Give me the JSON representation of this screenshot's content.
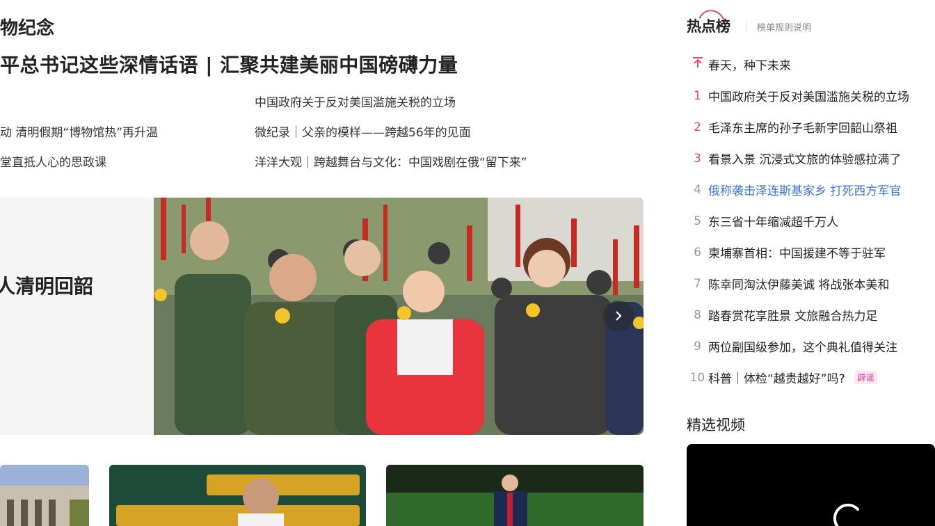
{
  "main": {
    "section_title": "物纪念",
    "headline": "平总书记这些深情话语 | 汇聚共建美丽中国磅礴力量",
    "sub_links": [
      "中国政府关于反对美国滥施关税的立场",
      "动 清明假期“博物馆热”再升温",
      "微纪录｜父亲的模样——跨越56年的见面",
      "堂直抵人心的思政课",
      "洋洋大观｜跨越舞台与文化：中国戏剧在俄“留下来”"
    ],
    "feature": {
      "caption": "人清明回韶",
      "next_icon": "chevron-right-icon"
    }
  },
  "sidebar": {
    "hot_title": "热点榜",
    "hot_rules": "榜单规则说明",
    "hot_items": [
      {
        "rank": "",
        "icon": "pin-top-icon",
        "text": "春天，种下未来"
      },
      {
        "rank": "1",
        "text": "中国政府关于反对美国滥施关税的立场"
      },
      {
        "rank": "2",
        "text": "毛泽东主席的孙子毛新宇回韶山祭祖"
      },
      {
        "rank": "3",
        "text": "看景入景 沉浸式文旅的体验感拉满了"
      },
      {
        "rank": "4",
        "text": "俄称袭击泽连斯基家乡 打死西方军官"
      },
      {
        "rank": "5",
        "text": "东三省十年缩减超千万人"
      },
      {
        "rank": "6",
        "text": "柬埔寨首相：中国援建不等于驻军"
      },
      {
        "rank": "7",
        "text": "陈幸同淘汰伊藤美诚 将战张本美和"
      },
      {
        "rank": "8",
        "text": "踏春赏花享胜景 文旅融合热力足"
      },
      {
        "rank": "9",
        "text": "两位副国级参加，这个典礼值得关注"
      },
      {
        "rank": "10",
        "text": "科普｜体检“越贵越好”吗?",
        "badge": "辟谣"
      }
    ],
    "video_title": "精选视频"
  },
  "colors": {
    "accent_red": "#f04b5b",
    "link_blue": "#3a6fe0",
    "rumor_pink": "#e0368c"
  }
}
